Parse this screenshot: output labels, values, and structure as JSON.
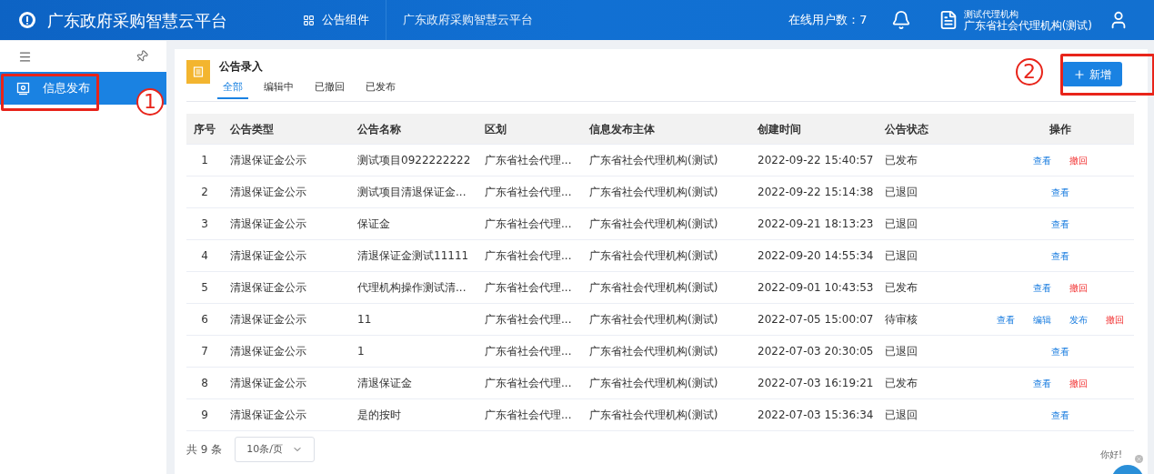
{
  "header": {
    "title": "广东政府采购智慧云平台",
    "nav": [
      {
        "label": "公告组件",
        "selected": true
      },
      {
        "label": "广东政府采购智慧云平台",
        "selected": false
      }
    ],
    "online_users": "在线用户数：7",
    "org_short": "测试代理机构",
    "org_full": "广东省社会代理机构(测试)"
  },
  "sidebar": {
    "items": [
      {
        "label": "信息发布",
        "selected": true
      }
    ]
  },
  "panel": {
    "title": "公告录入",
    "tabs": [
      {
        "label": "全部",
        "selected": true
      },
      {
        "label": "编辑中",
        "selected": false
      },
      {
        "label": "已撤回",
        "selected": false
      },
      {
        "label": "已发布",
        "selected": false
      }
    ],
    "add_button": "新增"
  },
  "annotations": [
    {
      "label": "1"
    },
    {
      "label": "2"
    }
  ],
  "table": {
    "columns": [
      "序号",
      "公告类型",
      "公告名称",
      "区划",
      "信息发布主体",
      "创建时间",
      "公告状态",
      "操作"
    ],
    "rows": [
      {
        "cells": [
          "1",
          "清退保证金公示",
          "测试项目0922222222",
          "广东省社会代理...",
          "广东省社会代理机构(测试)",
          "2022-09-22 15:40:57",
          "已发布"
        ],
        "actions": [
          {
            "kind": "view",
            "label": "查看"
          },
          {
            "kind": "withdraw",
            "label": "撤回"
          }
        ]
      },
      {
        "cells": [
          "2",
          "清退保证金公示",
          "测试项目清退保证金...",
          "广东省社会代理...",
          "广东省社会代理机构(测试)",
          "2022-09-22 15:14:38",
          "已退回"
        ],
        "actions": [
          {
            "kind": "view",
            "label": "查看"
          }
        ]
      },
      {
        "cells": [
          "3",
          "清退保证金公示",
          "保证金",
          "广东省社会代理...",
          "广东省社会代理机构(测试)",
          "2022-09-21 18:13:23",
          "已退回"
        ],
        "actions": [
          {
            "kind": "view",
            "label": "查看"
          }
        ]
      },
      {
        "cells": [
          "4",
          "清退保证金公示",
          "清退保证金测试11111",
          "广东省社会代理...",
          "广东省社会代理机构(测试)",
          "2022-09-20 14:55:34",
          "已退回"
        ],
        "actions": [
          {
            "kind": "view",
            "label": "查看"
          }
        ]
      },
      {
        "cells": [
          "5",
          "清退保证金公示",
          "代理机构操作测试清...",
          "广东省社会代理...",
          "广东省社会代理机构(测试)",
          "2022-09-01 10:43:53",
          "已发布"
        ],
        "actions": [
          {
            "kind": "view",
            "label": "查看"
          },
          {
            "kind": "withdraw",
            "label": "撤回"
          }
        ]
      },
      {
        "cells": [
          "6",
          "清退保证金公示",
          "11",
          "广东省社会代理...",
          "广东省社会代理机构(测试)",
          "2022-07-05 15:00:07",
          "待审核"
        ],
        "actions": [
          {
            "kind": "view",
            "label": "查看"
          },
          {
            "kind": "edit",
            "label": "编辑"
          },
          {
            "kind": "publish",
            "label": "发布"
          },
          {
            "kind": "withdraw",
            "label": "撤回"
          }
        ]
      },
      {
        "cells": [
          "7",
          "清退保证金公示",
          "1",
          "广东省社会代理...",
          "广东省社会代理机构(测试)",
          "2022-07-03 20:30:05",
          "已退回"
        ],
        "actions": [
          {
            "kind": "view",
            "label": "查看"
          }
        ]
      },
      {
        "cells": [
          "8",
          "清退保证金公示",
          "清退保证金",
          "广东省社会代理...",
          "广东省社会代理机构(测试)",
          "2022-07-03 16:19:21",
          "已发布"
        ],
        "actions": [
          {
            "kind": "view",
            "label": "查看"
          },
          {
            "kind": "withdraw",
            "label": "撤回"
          }
        ]
      },
      {
        "cells": [
          "9",
          "清退保证金公示",
          "是的按时",
          "广东省社会代理...",
          "广东省社会代理机构(测试)",
          "2022-07-03 15:36:34",
          "已退回"
        ],
        "actions": [
          {
            "kind": "view",
            "label": "查看"
          }
        ]
      }
    ]
  },
  "pagination": {
    "total": "共 9 条",
    "page_size": "10条/页"
  },
  "chat": {
    "greeting": "你好!"
  }
}
